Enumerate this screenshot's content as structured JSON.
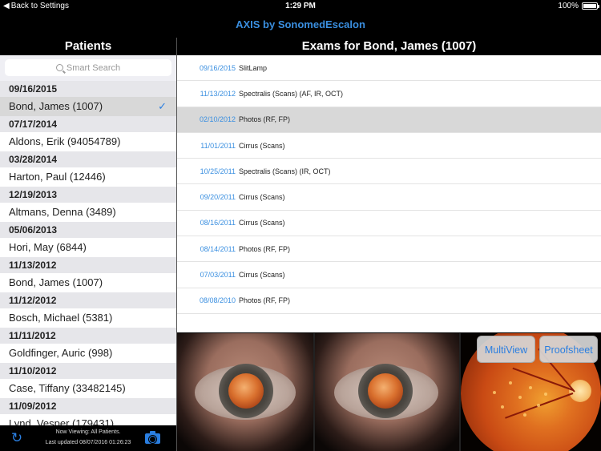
{
  "status": {
    "back_label": "Back to Settings",
    "time": "1:29 PM",
    "battery_text": "100%",
    "battery_level": 1.0
  },
  "app": {
    "title": "AXIS by SonomedEscalon"
  },
  "patients_panel": {
    "title": "Patients",
    "search_placeholder": "Smart Search",
    "groups": [
      {
        "date": "09/16/2015",
        "patient": "Bond, James (1007)",
        "selected": true
      },
      {
        "date": "07/17/2014",
        "patient": "Aldons, Erik (94054789)"
      },
      {
        "date": "03/28/2014",
        "patient": "Harton, Paul (12446)"
      },
      {
        "date": "12/19/2013",
        "patient": "Altmans, Denna (3489)"
      },
      {
        "date": "05/06/2013",
        "patient": "Hori, May (6844)"
      },
      {
        "date": "11/13/2012",
        "patient": "Bond, James (1007)"
      },
      {
        "date": "11/12/2012",
        "patient": "Bosch, Michael (5381)"
      },
      {
        "date": "11/11/2012",
        "patient": "Goldfinger, Auric (998)"
      },
      {
        "date": "11/10/2012",
        "patient": "Case, Tiffany (33482145)"
      },
      {
        "date": "11/09/2012",
        "patient": "Lynd, Vesper (179431)"
      }
    ],
    "check_mark": "✓"
  },
  "footer": {
    "line1": "Now Viewing: All Patients.",
    "line2": "Last updated 08/07/2016 01:26:23"
  },
  "exams_panel": {
    "title": "Exams for Bond, James (1007)",
    "exams": [
      {
        "date": "09/16/2015",
        "desc": "SlitLamp"
      },
      {
        "date": "11/13/2012",
        "desc": "Spectralis (Scans) (AF, IR, OCT)"
      },
      {
        "date": "02/10/2012",
        "desc": "Photos (RF, FP)",
        "selected": true
      },
      {
        "date": "11/01/2011",
        "desc": "Cirrus (Scans)"
      },
      {
        "date": "10/25/2011",
        "desc": "Spectralis (Scans) (IR, OCT)"
      },
      {
        "date": "09/20/2011",
        "desc": "Cirrus (Scans)"
      },
      {
        "date": "08/16/2011",
        "desc": "Cirrus (Scans)"
      },
      {
        "date": "08/14/2011",
        "desc": "Photos (RF, FP)"
      },
      {
        "date": "07/03/2011",
        "desc": "Cirrus (Scans)"
      },
      {
        "date": "08/08/2010",
        "desc": "Photos (RF, FP)"
      }
    ]
  },
  "image_strip": {
    "multiview_label": "MultiView",
    "proofsheet_label": "Proofsheet",
    "images": [
      "eye-photo",
      "eye-photo",
      "fundus-photo"
    ]
  },
  "colors": {
    "accent": "#2a7ee0",
    "title_blue": "#3a8fe0",
    "selected_row": "#d8d8d8"
  }
}
